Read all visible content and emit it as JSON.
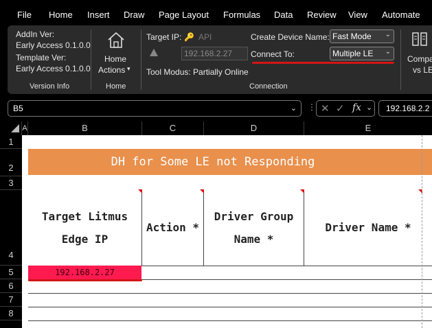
{
  "menu": [
    "File",
    "Home",
    "Insert",
    "Draw",
    "Page Layout",
    "Formulas",
    "Data",
    "Review",
    "View",
    "Automate"
  ],
  "ribbon": {
    "addin_ver_label": "AddIn Ver:",
    "addin_ver_value": "Early Access 0.1.0.0",
    "template_ver_label": "Template Ver:",
    "template_ver_value": "Early Access 0.1.0.0",
    "version_group": "Version Info",
    "home_actions_line1": "Home",
    "home_actions_line2": "Actions",
    "home_group": "Home",
    "target_ip_label": "Target IP:",
    "api_label": "API",
    "ip_value": "192.168.2.27",
    "tool_modus": "Tool Modus: Partially Online",
    "create_device_label": "Create Device Name:",
    "create_device_value": "Fast Mode",
    "connect_to_label": "Connect To:",
    "connect_to_value": "Multiple LE",
    "connection_group": "Connection",
    "compare_line1": "Compa",
    "compare_line2": "vs LE",
    "accent_underline": "#d41515"
  },
  "formula_bar": {
    "name_box": "B5",
    "formula_value": "192.168.2.2"
  },
  "sheet": {
    "columns": [
      "A",
      "B",
      "C",
      "D",
      "E"
    ],
    "rows": [
      "1",
      "2",
      "3",
      "4",
      "5",
      "6",
      "7",
      "8"
    ],
    "title": "DH for Some LE not Responding",
    "title_color": "#e8904c",
    "headers": {
      "b_line1": "Target Litmus",
      "b_line2": "Edge IP",
      "c_line1": "Action *",
      "d_line1": "Driver Group",
      "d_line2": "Name *",
      "e_line1": "Driver Name *"
    },
    "cell_b5": "192.168.2.27",
    "cell_b5_color": "#ff1a4f"
  }
}
